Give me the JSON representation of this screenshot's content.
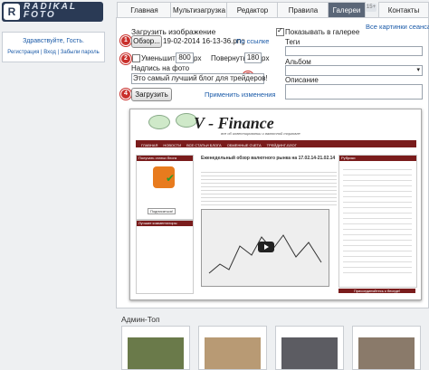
{
  "logo": {
    "mark": "R",
    "line1": "RADIKAL",
    "line2": "FOTO"
  },
  "user": {
    "greeting": "Здравствуйте, Гость.",
    "register": "Регистрация",
    "sep1": "|",
    "login": "Вход",
    "sep2": "|",
    "forgot": "Забыли пароль"
  },
  "tabs": [
    "Главная",
    "Мультизагрузка",
    "Редактор",
    "Правила",
    "Галереи",
    "Контакты"
  ],
  "tab_badge": "15+",
  "form": {
    "upload_title": "Загрузить изображение",
    "browse_label": "Обзор...",
    "file_name": "19-02-2014 16-13-36.png",
    "by_url": "По ссылке",
    "reduce_label": "Уменьшить до",
    "reduce_value": "800",
    "px1": "px",
    "rotate_label": "Повернуть",
    "rotate_value": "180",
    "px2": "px",
    "caption_label": "Надпись на фото",
    "caption_value": "Это самый лучший блог для трейдеров!",
    "upload_button": "Загрузить",
    "apply_changes": "Применить изменения",
    "show_in_gallery": "Показывать в галерее",
    "all_pictures": "Все картинки сеанса",
    "tags_label": "Теги",
    "album_label": "Альбом",
    "description_label": "Описание"
  },
  "steps": [
    "1",
    "2",
    "3",
    "4"
  ],
  "preview": {
    "title": "V - Finance",
    "subtitle": "все об инвестировании и валютной торговле",
    "nav": [
      "ГЛАВНАЯ",
      "НОВОСТИ",
      "ВСЕ СТАТЬИ БЛОГА",
      "ОБМЕННЫЕ СЧЕТА",
      "ТРЕЙДИНГ-БЛОГ"
    ],
    "post_title": "Еженедельный обзор валютного рынка на 17.02.14-21.02.14",
    "side_head_left": "Получать статьи блога",
    "side_head_left2": "Лучшие комментаторы",
    "side_head_right": "Рубрики",
    "subscribe": "Подписаться!",
    "footer_note": "Присоединяйтесь к беседе!"
  },
  "admin_top": {
    "label": "Админ-Топ"
  },
  "colors": {
    "step": "#c9302c",
    "link": "#1a5aa8",
    "preview_nav": "#7a1c1c",
    "dark_tab": "#5a6677"
  }
}
